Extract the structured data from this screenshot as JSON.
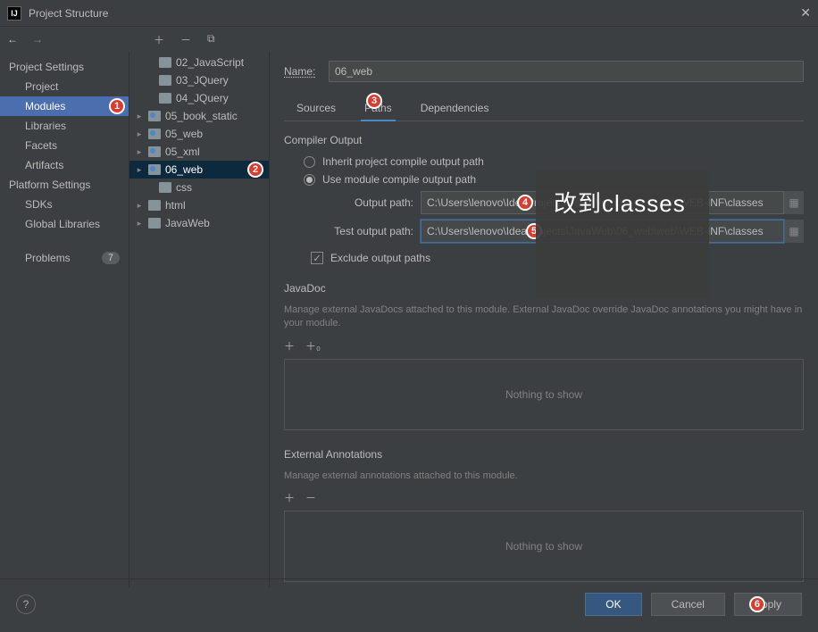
{
  "window": {
    "title": "Project Structure"
  },
  "sidebar": {
    "sections": [
      {
        "title": "Project Settings",
        "items": [
          "Project",
          "Modules",
          "Libraries",
          "Facets",
          "Artifacts"
        ],
        "selected": "Modules"
      },
      {
        "title": "Platform Settings",
        "items": [
          "SDKs",
          "Global Libraries"
        ]
      }
    ],
    "problems": {
      "label": "Problems",
      "count": "7"
    }
  },
  "tree": {
    "items": [
      {
        "label": "02_JavaScript",
        "indent": 1
      },
      {
        "label": "03_JQuery",
        "indent": 1
      },
      {
        "label": "04_JQuery",
        "indent": 1
      },
      {
        "label": "05_book_static",
        "indent": 0,
        "chev": true,
        "src": true
      },
      {
        "label": "05_web",
        "indent": 0,
        "chev": true,
        "src": true
      },
      {
        "label": "05_xml",
        "indent": 0,
        "chev": true,
        "src": true
      },
      {
        "label": "06_web",
        "indent": 0,
        "chev": true,
        "src": true,
        "selected": true
      },
      {
        "label": "css",
        "indent": 1
      },
      {
        "label": "html",
        "indent": 0,
        "chev": true
      },
      {
        "label": "JavaWeb",
        "indent": 0,
        "chev": true
      }
    ]
  },
  "module": {
    "nameLabel": "Name:",
    "name": "06_web",
    "tabs": [
      "Sources",
      "Paths",
      "Dependencies"
    ],
    "activeTab": "Paths",
    "compiler": {
      "title": "Compiler Output",
      "inherit": "Inherit project compile output path",
      "useModule": "Use module compile output path",
      "outputLabel": "Output path:",
      "outputPath": "C:\\Users\\lenovo\\IdeaProjects\\JavaWeb\\06_web\\web\\WEB-INF\\classes",
      "testLabel": "Test output path:",
      "testPath": "C:\\Users\\lenovo\\IdeaProjects\\JavaWeb\\06_web\\web\\WEB-INF\\classes",
      "exclude": "Exclude output paths"
    },
    "javadoc": {
      "title": "JavaDoc",
      "desc": "Manage external JavaDocs attached to this module. External JavaDoc override JavaDoc annotations you might have in your module.",
      "empty": "Nothing to show"
    },
    "extAnno": {
      "title": "External Annotations",
      "desc": "Manage external annotations attached to this module.",
      "empty": "Nothing to show"
    }
  },
  "footer": {
    "ok": "OK",
    "cancel": "Cancel",
    "apply": "Apply"
  },
  "overlay": {
    "text": "改到classes"
  },
  "badges": {
    "b1": "1",
    "b2": "2",
    "b3": "3",
    "b4": "4",
    "b5": "5",
    "b6": "6"
  }
}
